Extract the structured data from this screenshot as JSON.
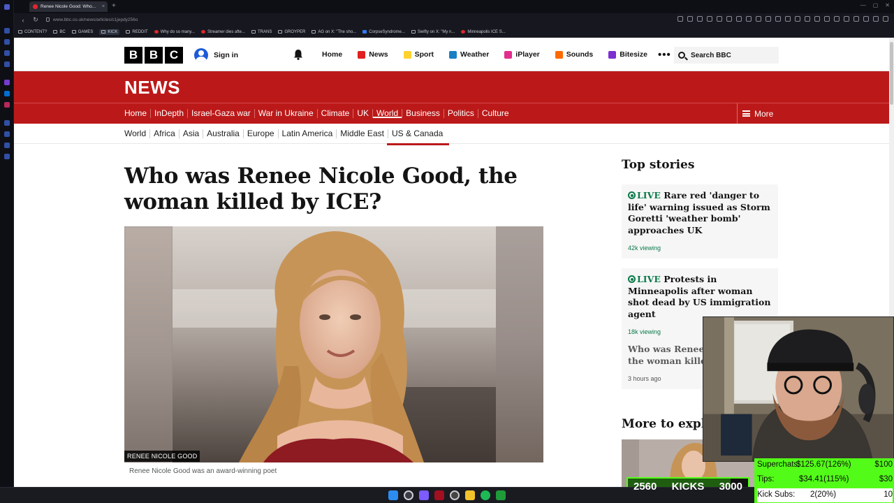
{
  "browser": {
    "tab_title": "Renee Nicole Good: Who...",
    "url": "www.bbc.co.uk/news/articles/c1jepdy256o",
    "bookmarks": [
      "CONTENT?",
      "BC",
      "GAMES",
      "KICK",
      "REDDIT",
      "Why do so many...",
      "Streamer dies afte...",
      "TRANS",
      "GROYPER",
      "AG on X: \"The sho...",
      "CorpseSyndrome...",
      "Swifty on X: \"My n...",
      "Minneapolis ICE S..."
    ]
  },
  "bbc": {
    "signin": "Sign in",
    "nav": [
      "Home",
      "News",
      "Sport",
      "Weather",
      "iPlayer",
      "Sounds",
      "Bitesize"
    ],
    "more_dots": "•••",
    "search_placeholder": "Search BBC",
    "news_logo": "NEWS",
    "sections": [
      "Home",
      "InDepth",
      "Israel-Gaza war",
      "War in Ukraine",
      "Climate",
      "UK",
      "World",
      "Business",
      "Politics",
      "Culture"
    ],
    "more_label": "More",
    "subsections": [
      "World",
      "Africa",
      "Asia",
      "Australia",
      "Europe",
      "Latin America",
      "Middle East",
      "US & Canada"
    ]
  },
  "article": {
    "headline": "Who was Renee Nicole Good, the woman killed by ICE?",
    "image_tag": "RENEE NICOLE GOOD",
    "caption": "Renee Nicole Good was an award-winning poet"
  },
  "sidebar": {
    "title": "Top stories",
    "stories": [
      {
        "live": "LIVE",
        "text": "Rare red 'danger to life' warning issued as Storm Goretti 'weather bomb' approaches UK",
        "meta": "42k viewing"
      },
      {
        "live": "LIVE",
        "text": "Protests in Minneapolis after woman shot dead by US immigration agent",
        "meta": "18k viewing"
      },
      {
        "live": "",
        "text": "Who was Renee Nicole Good, the woman killed by ICE?",
        "meta": "3 hours ago"
      }
    ],
    "more_to_explore": "More to explore"
  },
  "stream": {
    "kicks_current": "2560",
    "kicks_label": "KICKS",
    "kicks_goal": "3000",
    "kicks_progress_fraction": 0.853,
    "superchats_label": "Superchats:",
    "superchats_value": "$125.67(126%)",
    "superchats_goal": "$100",
    "tips_label": "Tips:",
    "tips_value": "$34.41(115%)",
    "tips_goal": "$30",
    "subs_label": "Kick Subs:",
    "subs_value": "2(20%)",
    "subs_goal": "10"
  },
  "colors": {
    "bbc_red": "#bb1919",
    "live_green": "#0a7a4a",
    "kick_green": "#53fc18"
  }
}
